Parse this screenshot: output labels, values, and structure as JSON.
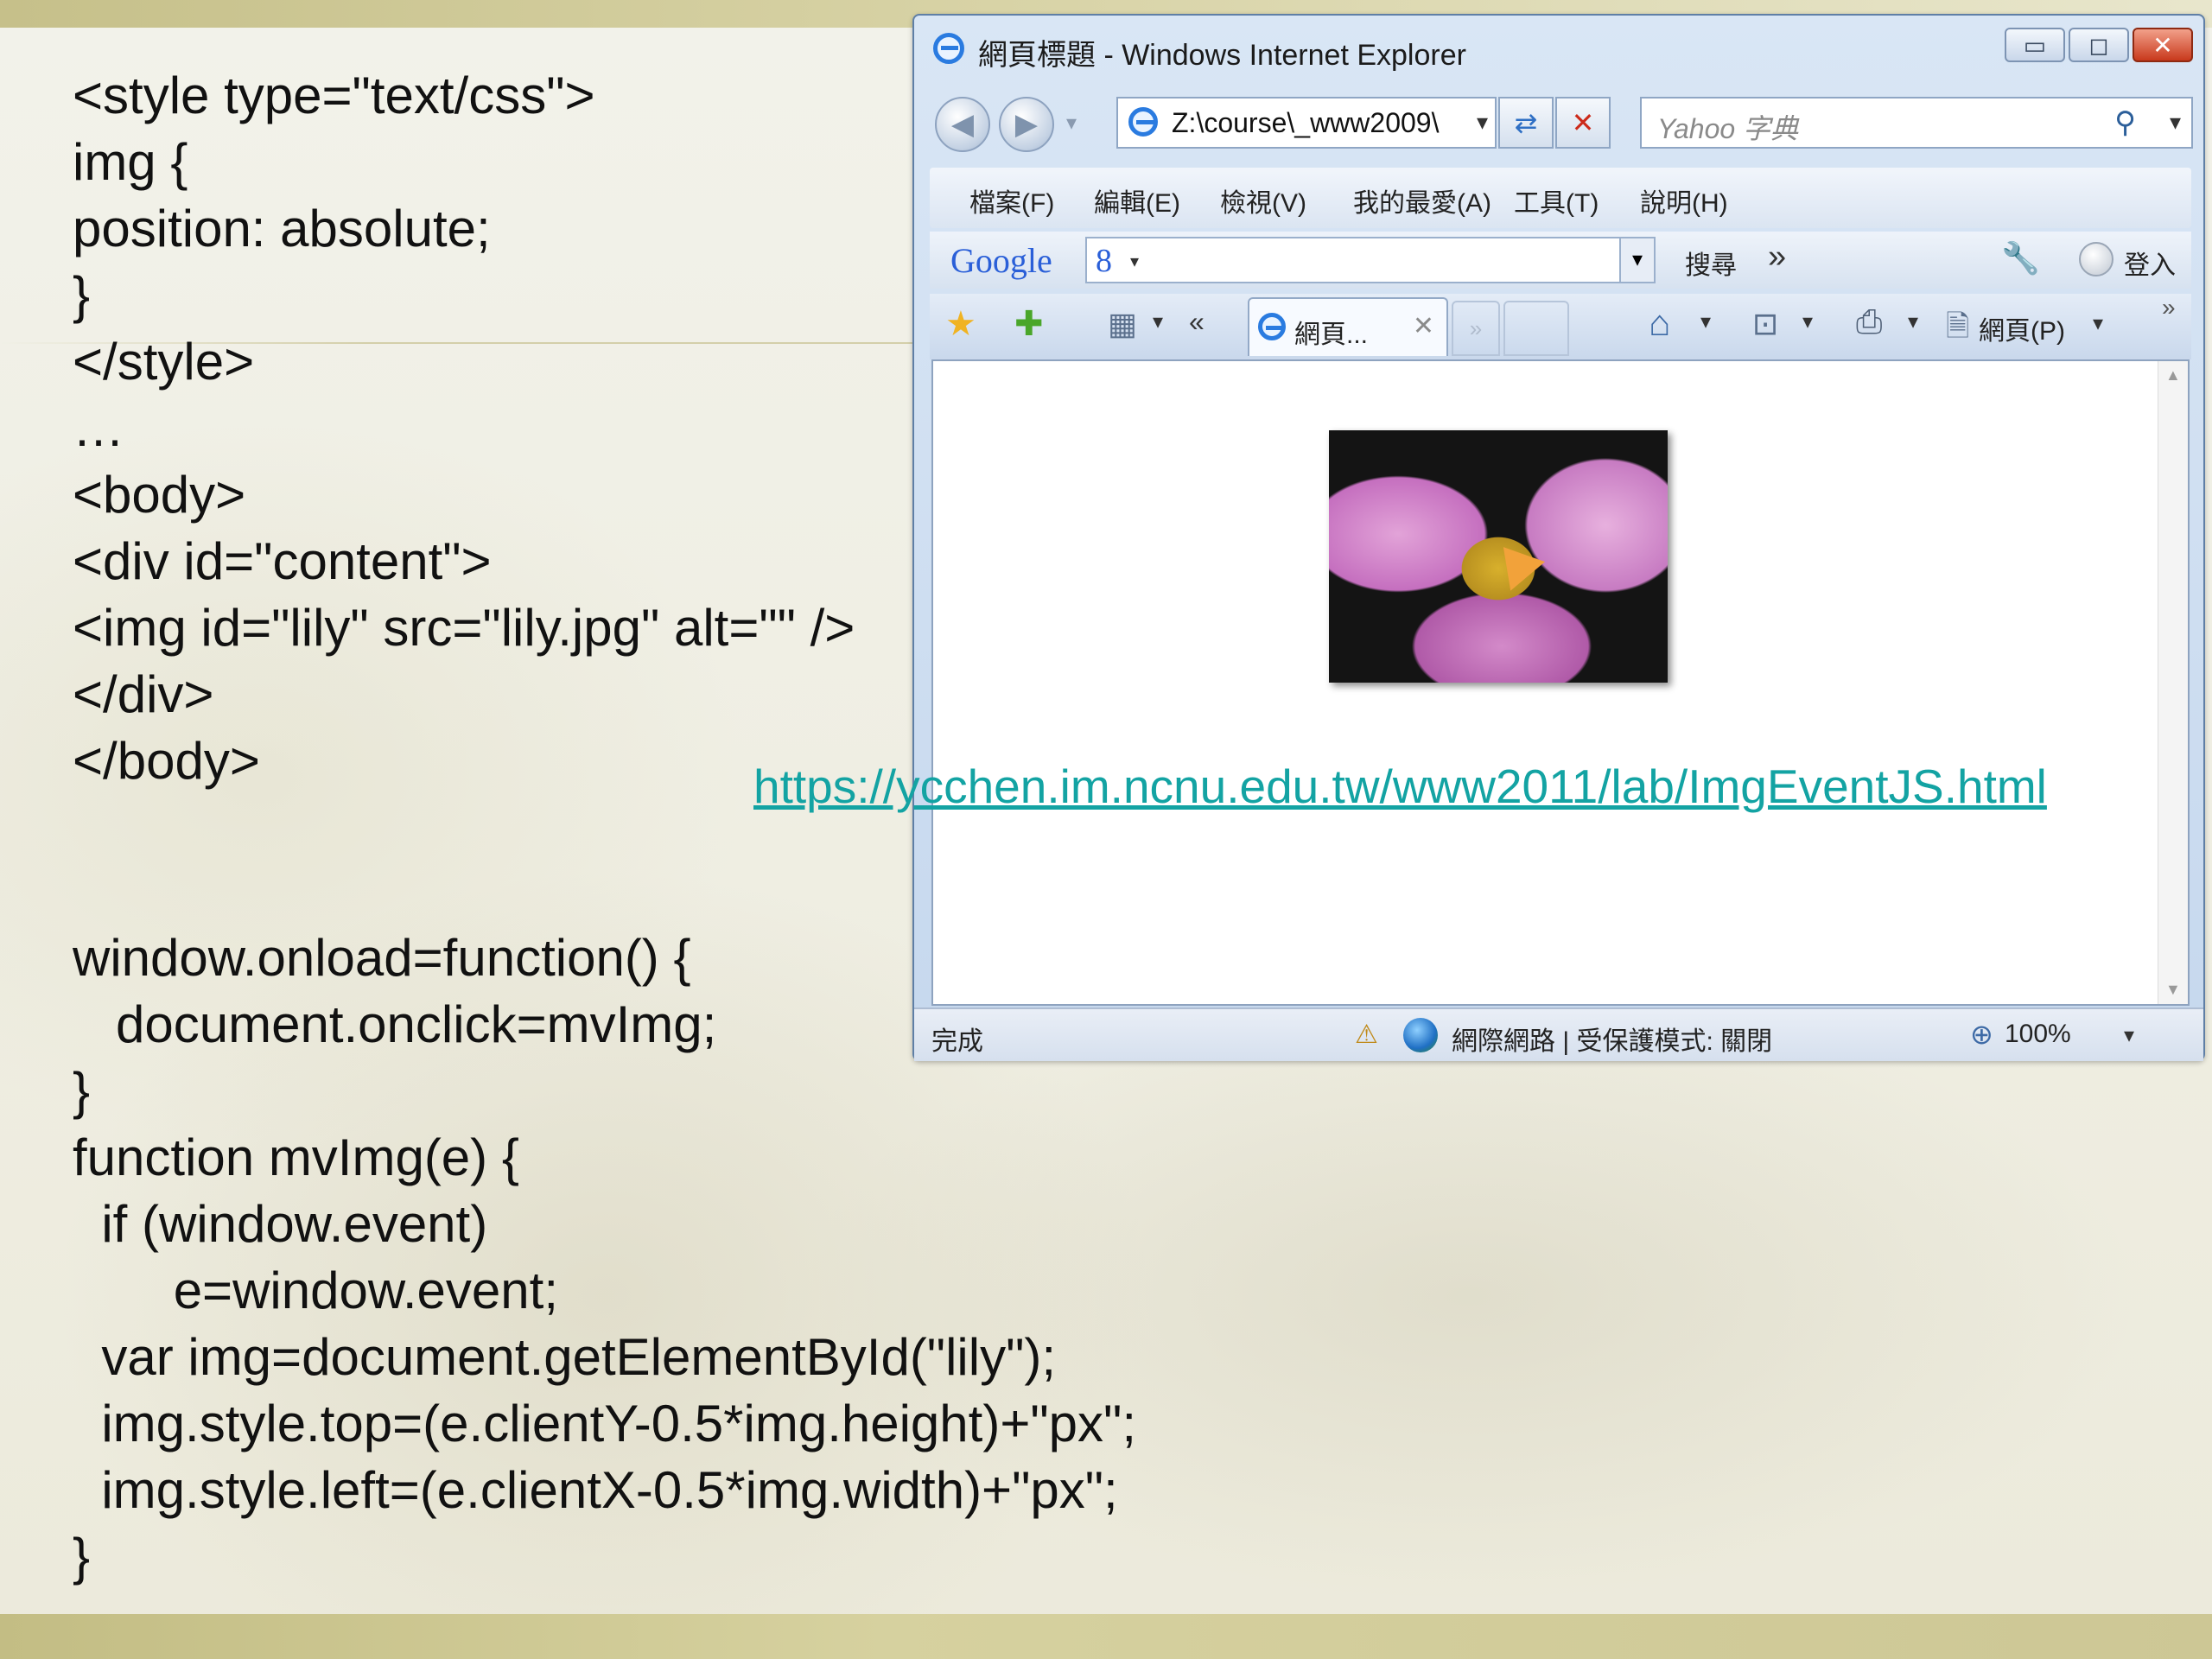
{
  "slide": {
    "code_top": [
      "<style type=\"text/css\">",
      "img {",
      "position: absolute;",
      "}",
      "</style>",
      "…",
      "<body>",
      "<div id=\"content\">",
      "<img id=\"lily\" src=\"lily.jpg\" alt=\"\" />",
      "</div>",
      "</body>"
    ],
    "code_bottom": [
      "window.onload=function() {",
      "   document.onclick=mvImg;",
      "}",
      "function mvImg(e) {",
      "  if (window.event)",
      "       e=window.event;",
      "  var img=document.getElementById(\"lily\");",
      "  img.style.top=(e.clientY-0.5*img.height)+\"px\";",
      "  img.style.left=(e.clientX-0.5*img.width)+\"px\";",
      "}"
    ],
    "link_url": "https://ycchen.im.ncnu.edu.tw/www2011/lab/ImgEventJS.html"
  },
  "browser": {
    "title": "網頁標題 - Windows Internet Explorer",
    "address": "Z:\\course\\_www2009\\",
    "search_placeholder": "Yahoo 字典",
    "menu": [
      "檔案(F)",
      "編輯(E)",
      "檢視(V)",
      "我的最愛(A)",
      "工具(T)",
      "說明(H)"
    ],
    "google_label": "Google",
    "google_search_button": "搜尋",
    "signin_label": "登入",
    "tab_title": "網頁...",
    "page_menu": "網頁(P)",
    "status_done": "完成",
    "status_zone": "網際網路 | 受保護模式: 關閉",
    "zoom": "100%"
  },
  "colors": {
    "link": "#13a3a3",
    "band": "#c6c08a",
    "window_frame": "#5f7fa6"
  }
}
